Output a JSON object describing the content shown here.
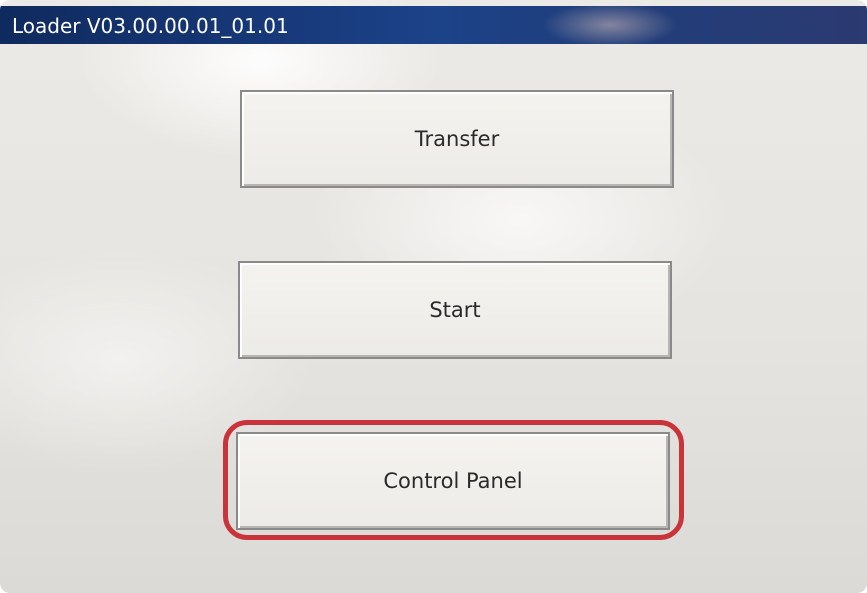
{
  "window": {
    "title": "Loader V03.00.00.01_01.01"
  },
  "buttons": {
    "transfer": "Transfer",
    "start": "Start",
    "control_panel": "Control Panel"
  },
  "colors": {
    "titlebar": "#1c4288",
    "highlight": "#c9343b",
    "background": "#e8e6e2"
  }
}
